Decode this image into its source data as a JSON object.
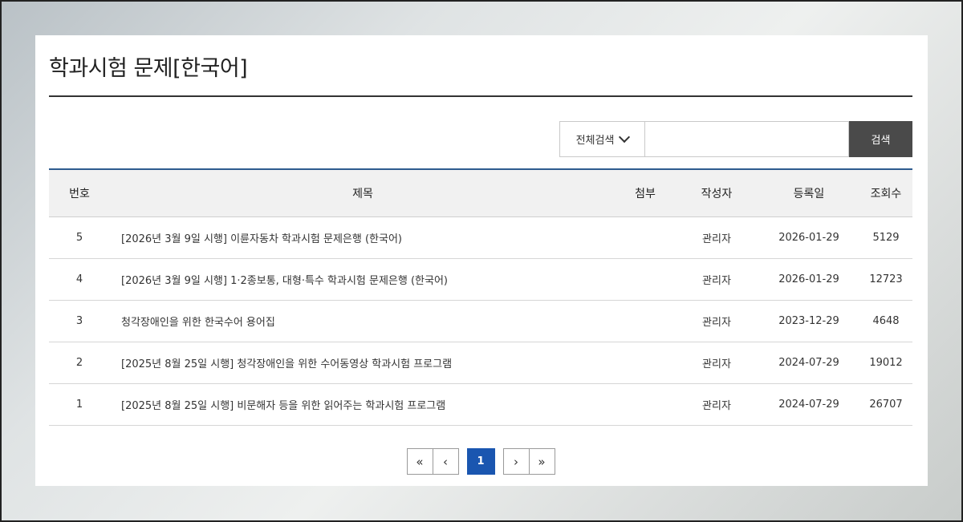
{
  "page": {
    "title": "학과시험 문제[한국어]"
  },
  "search": {
    "select_label": "전체검색",
    "input_value": "",
    "button_label": "검색"
  },
  "table": {
    "headers": [
      "번호",
      "제목",
      "첨부",
      "작성자",
      "등록일",
      "조회수"
    ],
    "rows": [
      {
        "no": "5",
        "subject": "[2026년 3월 9일 시행] 이륜자동차 학과시험 문제은행 (한국어)",
        "attach": "",
        "author": "관리자",
        "date": "2026-01-29",
        "views": "5129"
      },
      {
        "no": "4",
        "subject": "[2026년 3월 9일 시행] 1·2종보통, 대형·특수 학과시험 문제은행 (한국어)",
        "attach": "",
        "author": "관리자",
        "date": "2026-01-29",
        "views": "12723"
      },
      {
        "no": "3",
        "subject": "청각장애인을 위한 한국수어 용어집",
        "attach": "",
        "author": "관리자",
        "date": "2023-12-29",
        "views": "4648"
      },
      {
        "no": "2",
        "subject": "[2025년 8월 25일 시행] 청각장애인을 위한 수어동영상 학과시험 프로그램",
        "attach": "",
        "author": "관리자",
        "date": "2024-07-29",
        "views": "19012"
      },
      {
        "no": "1",
        "subject": "[2025년 8월 25일 시행] 비문해자 등을 위한 읽어주는 학과시험 프로그램",
        "attach": "",
        "author": "관리자",
        "date": "2024-07-29",
        "views": "26707"
      }
    ]
  },
  "pagination": {
    "first": "«",
    "prev": "‹",
    "current": "1",
    "next": "›",
    "last": "»",
    "active_color": "#1a56b0"
  }
}
